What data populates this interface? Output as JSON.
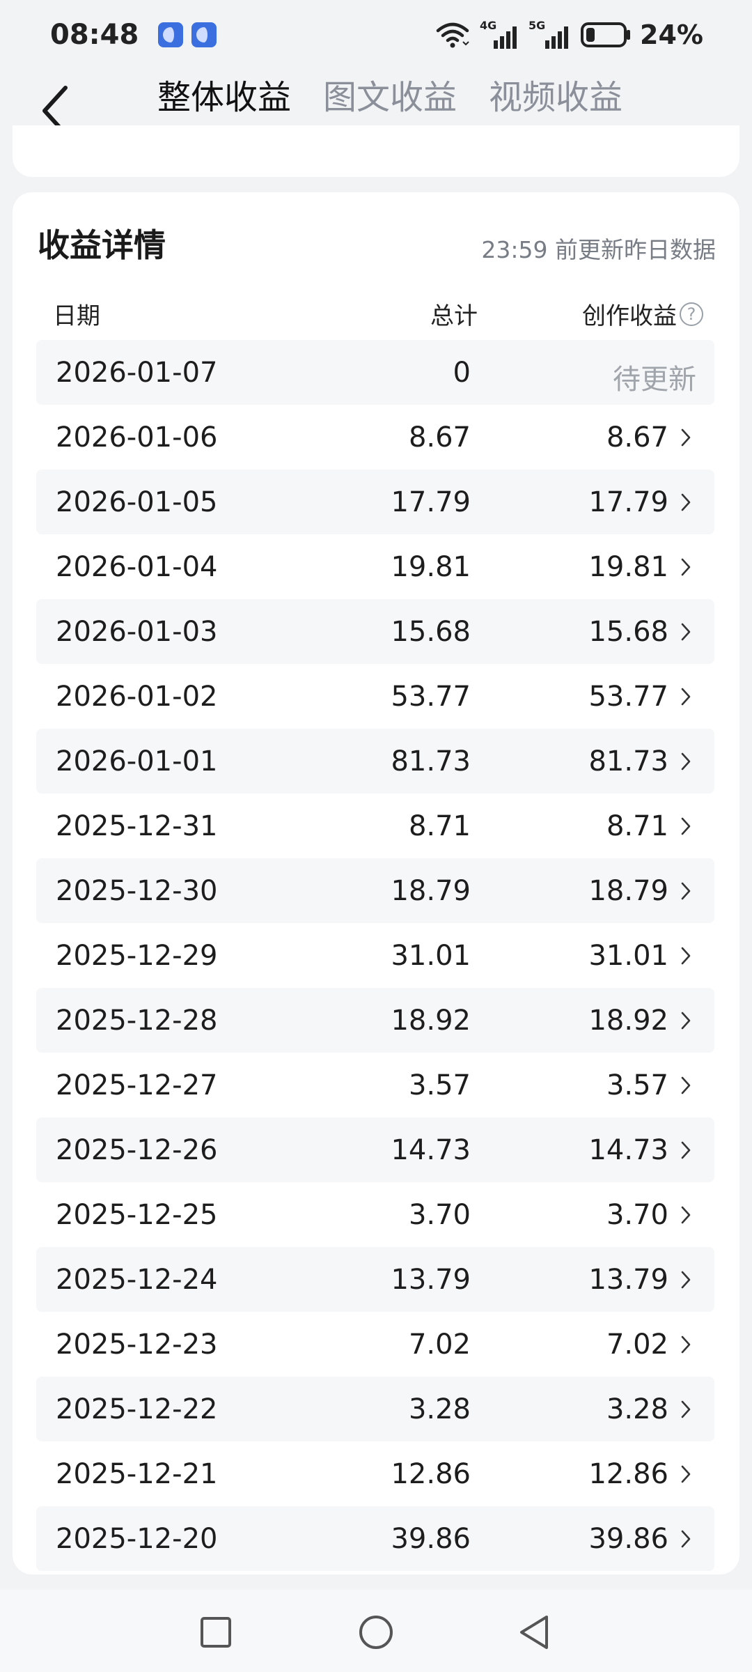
{
  "status_bar": {
    "time": "08:48",
    "battery_percent": "24%",
    "net_4g": "4G",
    "net_5g": "5G",
    "battery_level": 0.24
  },
  "header": {
    "tabs": [
      {
        "label": "整体收益",
        "active": true
      },
      {
        "label": "图文收益",
        "active": false
      },
      {
        "label": "视频收益",
        "active": false
      }
    ]
  },
  "details": {
    "title": "收益详情",
    "update_note": "23:59 前更新昨日数据",
    "columns": {
      "date": "日期",
      "total": "总计",
      "creator": "创作收益",
      "help_glyph": "?"
    },
    "rows": [
      {
        "date": "2026-01-07",
        "total": "0",
        "creator": "待更新"
      },
      {
        "date": "2026-01-06",
        "total": "8.67",
        "creator": "8.67"
      },
      {
        "date": "2026-01-05",
        "total": "17.79",
        "creator": "17.79"
      },
      {
        "date": "2026-01-04",
        "total": "19.81",
        "creator": "19.81"
      },
      {
        "date": "2026-01-03",
        "total": "15.68",
        "creator": "15.68"
      },
      {
        "date": "2026-01-02",
        "total": "53.77",
        "creator": "53.77"
      },
      {
        "date": "2026-01-01",
        "total": "81.73",
        "creator": "81.73"
      },
      {
        "date": "2025-12-31",
        "total": "8.71",
        "creator": "8.71"
      },
      {
        "date": "2025-12-30",
        "total": "18.79",
        "creator": "18.79"
      },
      {
        "date": "2025-12-29",
        "total": "31.01",
        "creator": "31.01"
      },
      {
        "date": "2025-12-28",
        "total": "18.92",
        "creator": "18.92"
      },
      {
        "date": "2025-12-27",
        "total": "3.57",
        "creator": "3.57"
      },
      {
        "date": "2025-12-26",
        "total": "14.73",
        "creator": "14.73"
      },
      {
        "date": "2025-12-25",
        "total": "3.70",
        "creator": "3.70"
      },
      {
        "date": "2025-12-24",
        "total": "13.79",
        "creator": "13.79"
      },
      {
        "date": "2025-12-23",
        "total": "7.02",
        "creator": "7.02"
      },
      {
        "date": "2025-12-22",
        "total": "3.28",
        "creator": "3.28"
      },
      {
        "date": "2025-12-21",
        "total": "12.86",
        "creator": "12.86"
      },
      {
        "date": "2025-12-20",
        "total": "39.86",
        "creator": "39.86"
      }
    ]
  },
  "colors": {
    "background": "#f2f3f5",
    "card": "#ffffff",
    "row_shade": "#f6f7f9",
    "muted_text": "#a0a4ab",
    "badge_blue": "#3b6fe0"
  },
  "icons": {
    "back": "chevron-left-icon",
    "row_arrow": "chevron-right-icon",
    "help": "question-circle-icon",
    "wifi": "wifi-icon",
    "signal": "cellular-signal-icon",
    "battery": "battery-icon",
    "nav_recent": "square-icon",
    "nav_home": "circle-icon",
    "nav_back": "triangle-back-icon"
  }
}
